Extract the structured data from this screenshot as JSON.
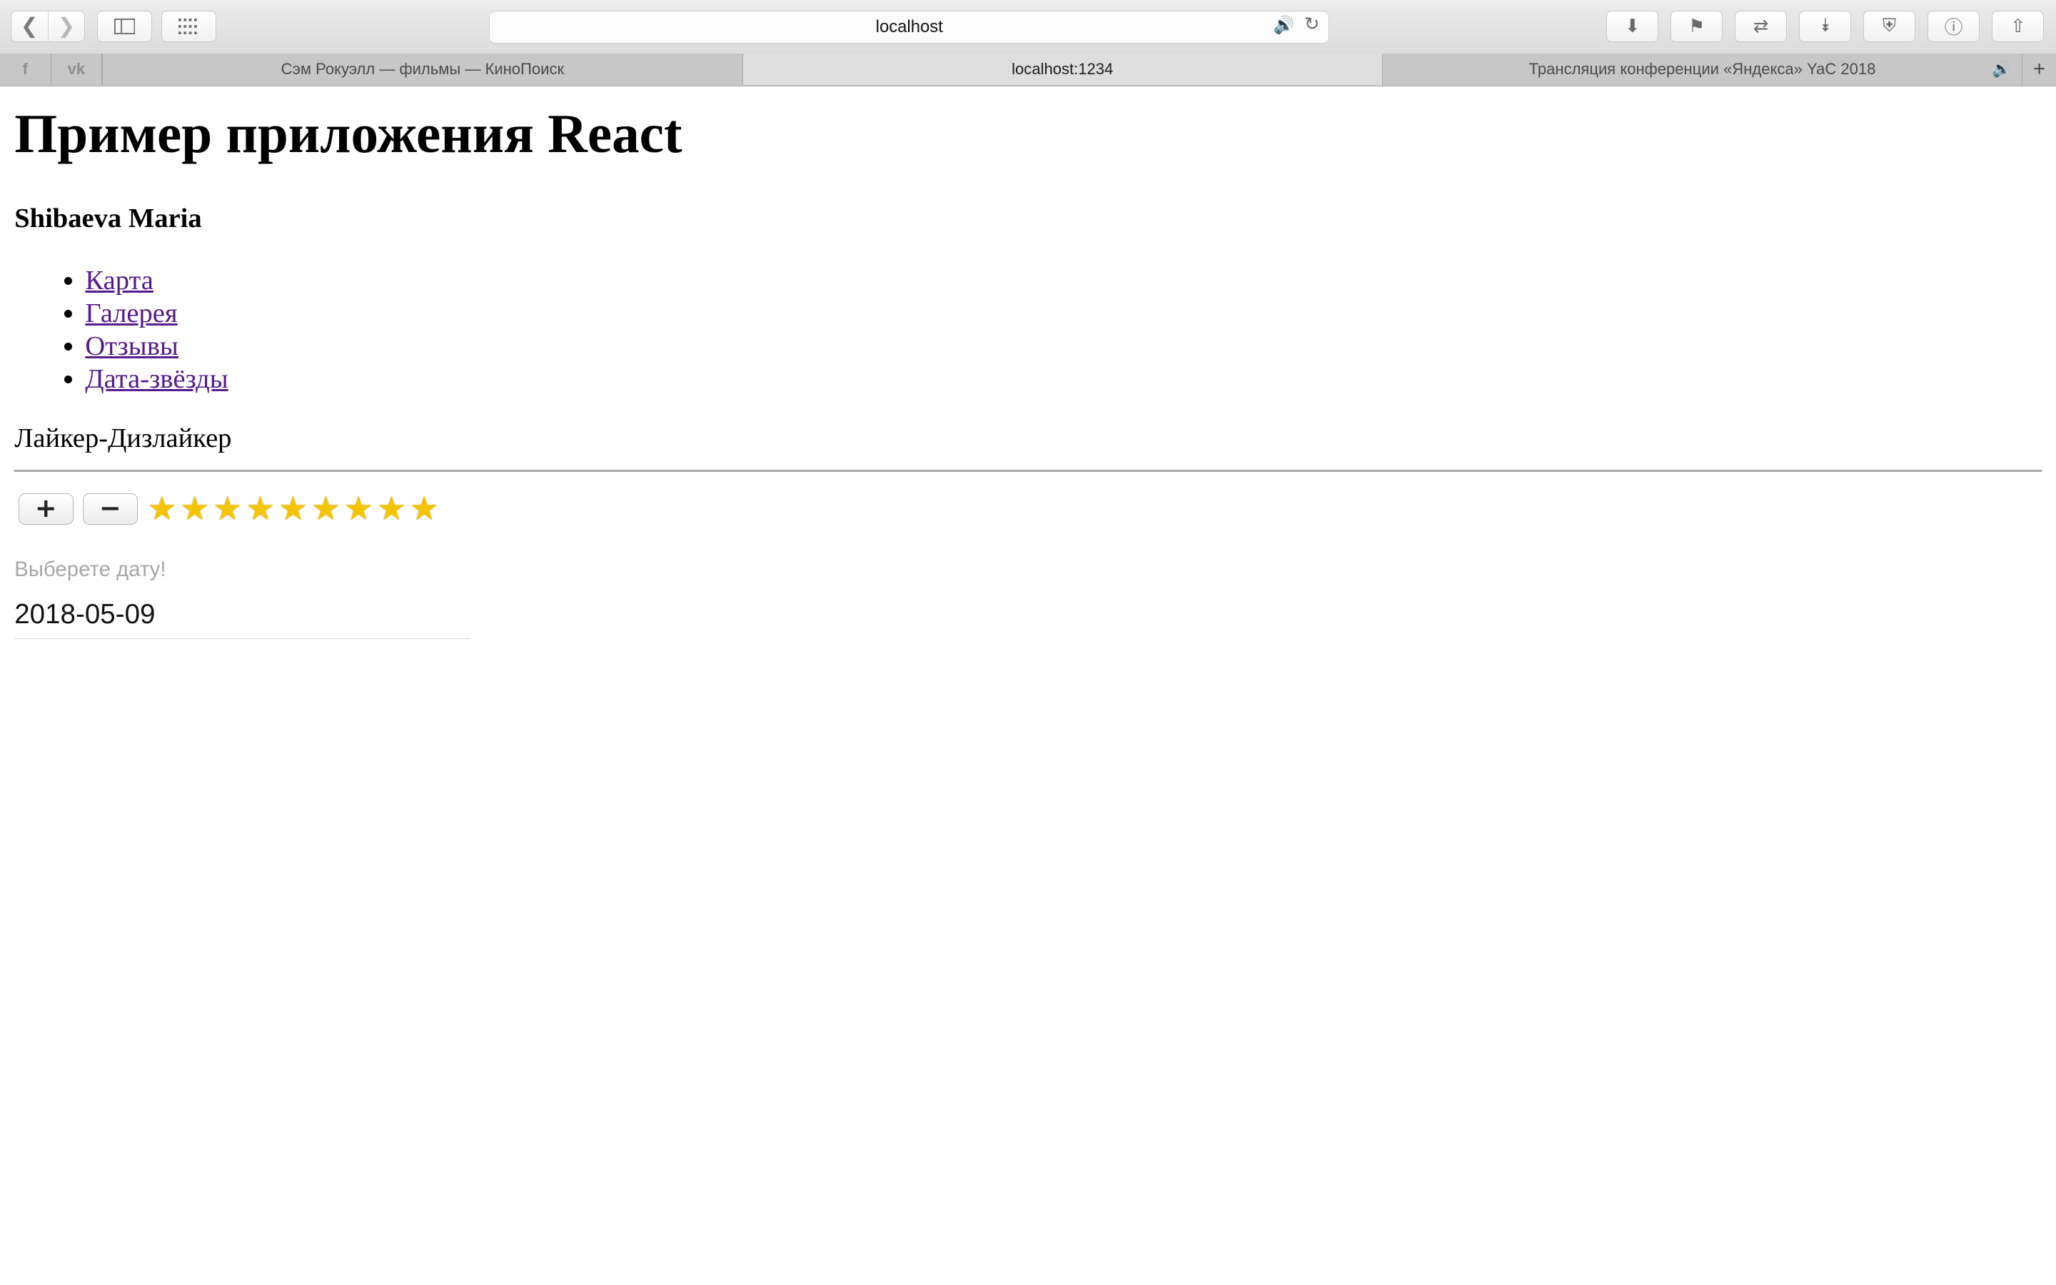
{
  "browser": {
    "url": "localhost",
    "tabs": [
      {
        "label": "Сэм Рокуэлл — фильмы — КиноПоиск"
      },
      {
        "label": "localhost:1234"
      },
      {
        "label": "Трансляция конференции «Яндекса» YaC 2018"
      }
    ],
    "pinned": [
      {
        "label": "f",
        "icon": "facebook-icon"
      },
      {
        "label": "vk",
        "icon": "vk-icon"
      }
    ],
    "accent_color": "#1a7cf5"
  },
  "page": {
    "title": "Пример приложения React",
    "author": "Shibaeva Maria",
    "menu": [
      "Карта",
      "Галерея",
      "Отзывы",
      "Дата-звёзды"
    ],
    "section_title": "Лайкер-Дизлайкер",
    "plus_label": "+",
    "minus_label": "−",
    "stars_count": 9,
    "date_placeholder": "Выберете дату!",
    "date_value": "2018-05-09"
  }
}
